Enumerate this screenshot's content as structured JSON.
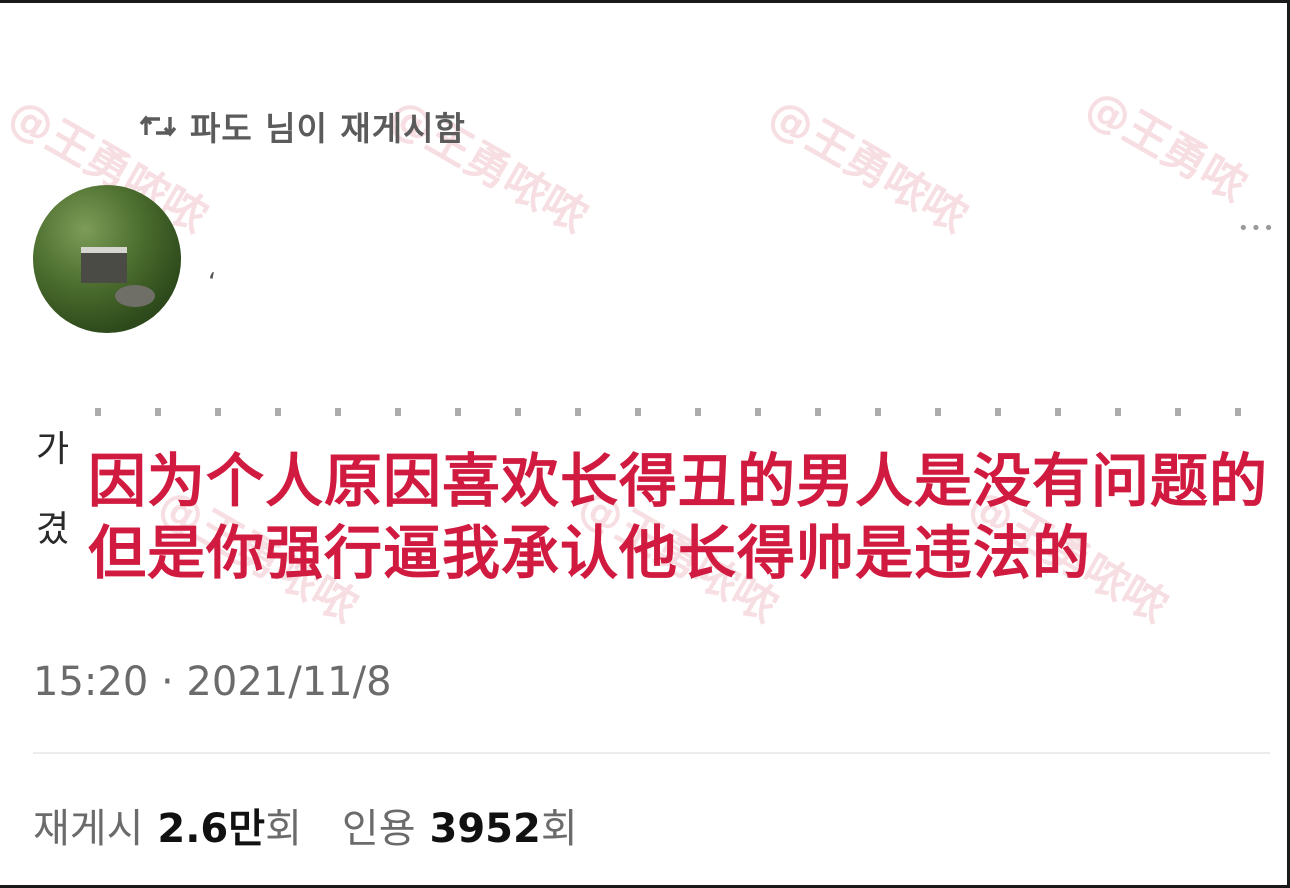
{
  "repost": {
    "text": "파도 님이 재게시함"
  },
  "author": {
    "name_fragment": "ʻ"
  },
  "tweet": {
    "partial_lines": [
      "가",
      "겼"
    ],
    "overlay_lines": [
      "因为个人原因喜欢长得丑的男人是没有问题的",
      "但是你强行逼我承认他长得帅是违法的"
    ],
    "timestamp": "15:20 · 2021/11/8"
  },
  "stats": {
    "repost_label": "재게시",
    "repost_count": "2.6만",
    "repost_unit": "회",
    "quote_label": "인용",
    "quote_count": "3952",
    "quote_unit": "회"
  },
  "menu": {
    "more_symbol": "•••"
  },
  "colors": {
    "overlay_text": "#d11a3f",
    "watermark": "#e8a9b4",
    "meta_text": "#6b6b6b"
  }
}
